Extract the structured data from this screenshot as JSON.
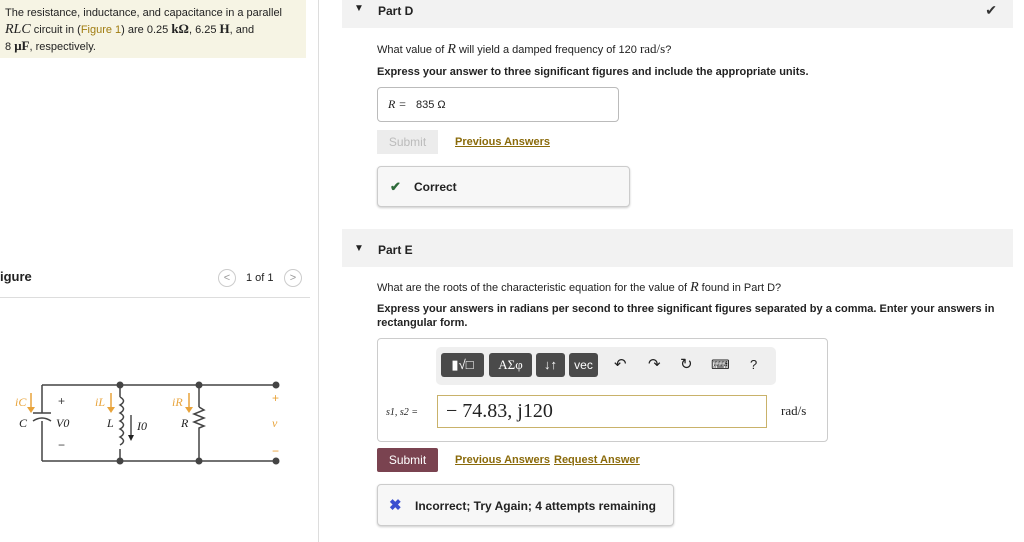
{
  "intro": {
    "t1": "The resistance, inductance, and capacitance in a parallel",
    "rlc": "RLC",
    "t2": " circuit in (",
    "fig": "Figure 1",
    "t3": ") are 0.25 ",
    "u1": "kΩ",
    "t4": ", 6.25 ",
    "u2": "H",
    "t5": ", and",
    "t6": "8 ",
    "u3": "μF",
    "t7": ", respectively."
  },
  "figure": {
    "title": "igure",
    "page": "1 of 1",
    "prev": "<",
    "next": ">",
    "labels": {
      "ic": "iC",
      "il": "iL",
      "ir": "iR",
      "c": "C",
      "v0": "V0",
      "l": "L",
      "i0": "I0",
      "r": "R",
      "v": "v",
      "plus": "+",
      "minus": "−"
    }
  },
  "partD": {
    "title": "Part D",
    "question_a": "What value of ",
    "R": "R",
    "question_b": " will yield a damped frequency of 120 ",
    "unit": "rad/s",
    "question_c": "?",
    "instr": "Express your answer to three significant figures and include the appropriate units.",
    "answer_label": "R = ",
    "answer_value": "835 Ω",
    "submit": "Submit",
    "prev": "Previous Answers",
    "feedback": "Correct"
  },
  "partE": {
    "title": "Part E",
    "question_a": "What are the roots of the characteristic equation for the value of ",
    "R": "R",
    "question_b": " found in Part D?",
    "instr": "Express your answers in radians per second to three significant figures separated by a comma. Enter your answers in rectangular form.",
    "toolbar": {
      "templates": "▮√□",
      "greek": "ΑΣφ",
      "arrows": "↓↑",
      "vec": "vec",
      "help": "?"
    },
    "answer_label": "s1, s2 =",
    "answer_value": "− 74.83, j120",
    "unit": "rad/s",
    "submit": "Submit",
    "prev": "Previous Answers",
    "request": "Request Answer",
    "feedback": "Incorrect; Try Again; 4 attempts remaining"
  },
  "colors": {
    "accent": "#a07c10",
    "submit": "#7a4350",
    "correct": "#2e6b3a",
    "incorrect": "#3a4fd0"
  }
}
